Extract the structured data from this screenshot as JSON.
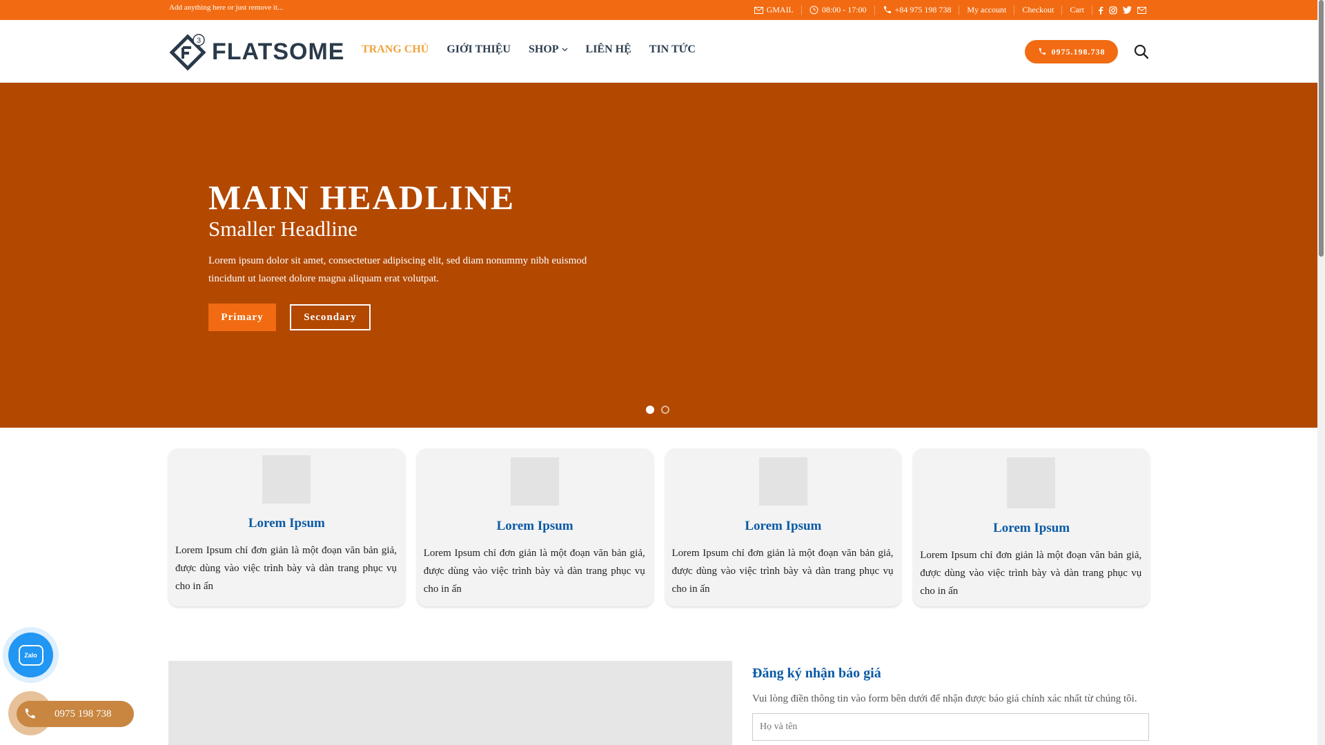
{
  "topbar": {
    "note": "Add anything here or just remove it...",
    "gmail": "GMAIL",
    "hours": "08:00 - 17:00",
    "phone": "+84 975 198 738",
    "my_account": "My account",
    "checkout": "Checkout",
    "cart": "Cart",
    "social_icons": [
      "facebook-icon",
      "instagram-icon",
      "twitter-icon",
      "email-icon"
    ]
  },
  "header": {
    "logo_text": "FLATSOME",
    "logo_badge": "3",
    "nav": [
      {
        "label": "TRANG CHỦ",
        "active": true
      },
      {
        "label": "GIỚI THIỆU"
      },
      {
        "label": "SHOP",
        "dropdown": true
      },
      {
        "label": "LIÊN HỆ"
      },
      {
        "label": "TIN TỨC"
      }
    ],
    "phone_button": "0975.198.738"
  },
  "hero": {
    "headline": "MAIN HEADLINE",
    "subheadline": "Smaller Headline",
    "body": "Lorem ipsum dolor sit amet, consectetuer adipiscing elit, sed diam nonummy nibh euismod tincidunt ut laoreet dolore magna aliquam erat volutpat.",
    "primary_button": "Primary",
    "secondary_button": "Secondary",
    "background": "#b34800"
  },
  "cards": [
    {
      "title": "Lorem Ipsum",
      "text": "Lorem Ipsum chỉ đơn giản là một đoạn văn bản giả, được dùng vào việc trình bày và dàn trang phục vụ cho in ấn"
    },
    {
      "title": "Lorem Ipsum",
      "text": "Lorem Ipsum chỉ đơn giản là một đoạn văn bản giả, được dùng vào việc trình bày và dàn trang phục vụ cho in ấn"
    },
    {
      "title": "Lorem Ipsum",
      "text": "Lorem Ipsum chỉ đơn giản là một đoạn văn bản giả, được dùng vào việc trình bày và dàn trang phục vụ cho in ấn"
    },
    {
      "title": "Lorem Ipsum",
      "text": "Lorem Ipsum chỉ đơn giản là một đoạn văn bản giả, được dùng vào việc trình bày và dàn trang phục vụ cho in ấn"
    }
  ],
  "quote": {
    "title": "Đăng ký nhận báo giá",
    "description": "Vui lòng điền thông tin vào form bên dưới để nhận được báo giá chính xác nhất từ chúng tôi.",
    "name_placeholder": "Họ và tên"
  },
  "floating": {
    "zalo_label": "Zalo",
    "call_label": "0975 198 738"
  },
  "colors": {
    "accent": "#f26b12",
    "nav_active": "#f0a33a",
    "card_title": "#0b5aa5"
  }
}
